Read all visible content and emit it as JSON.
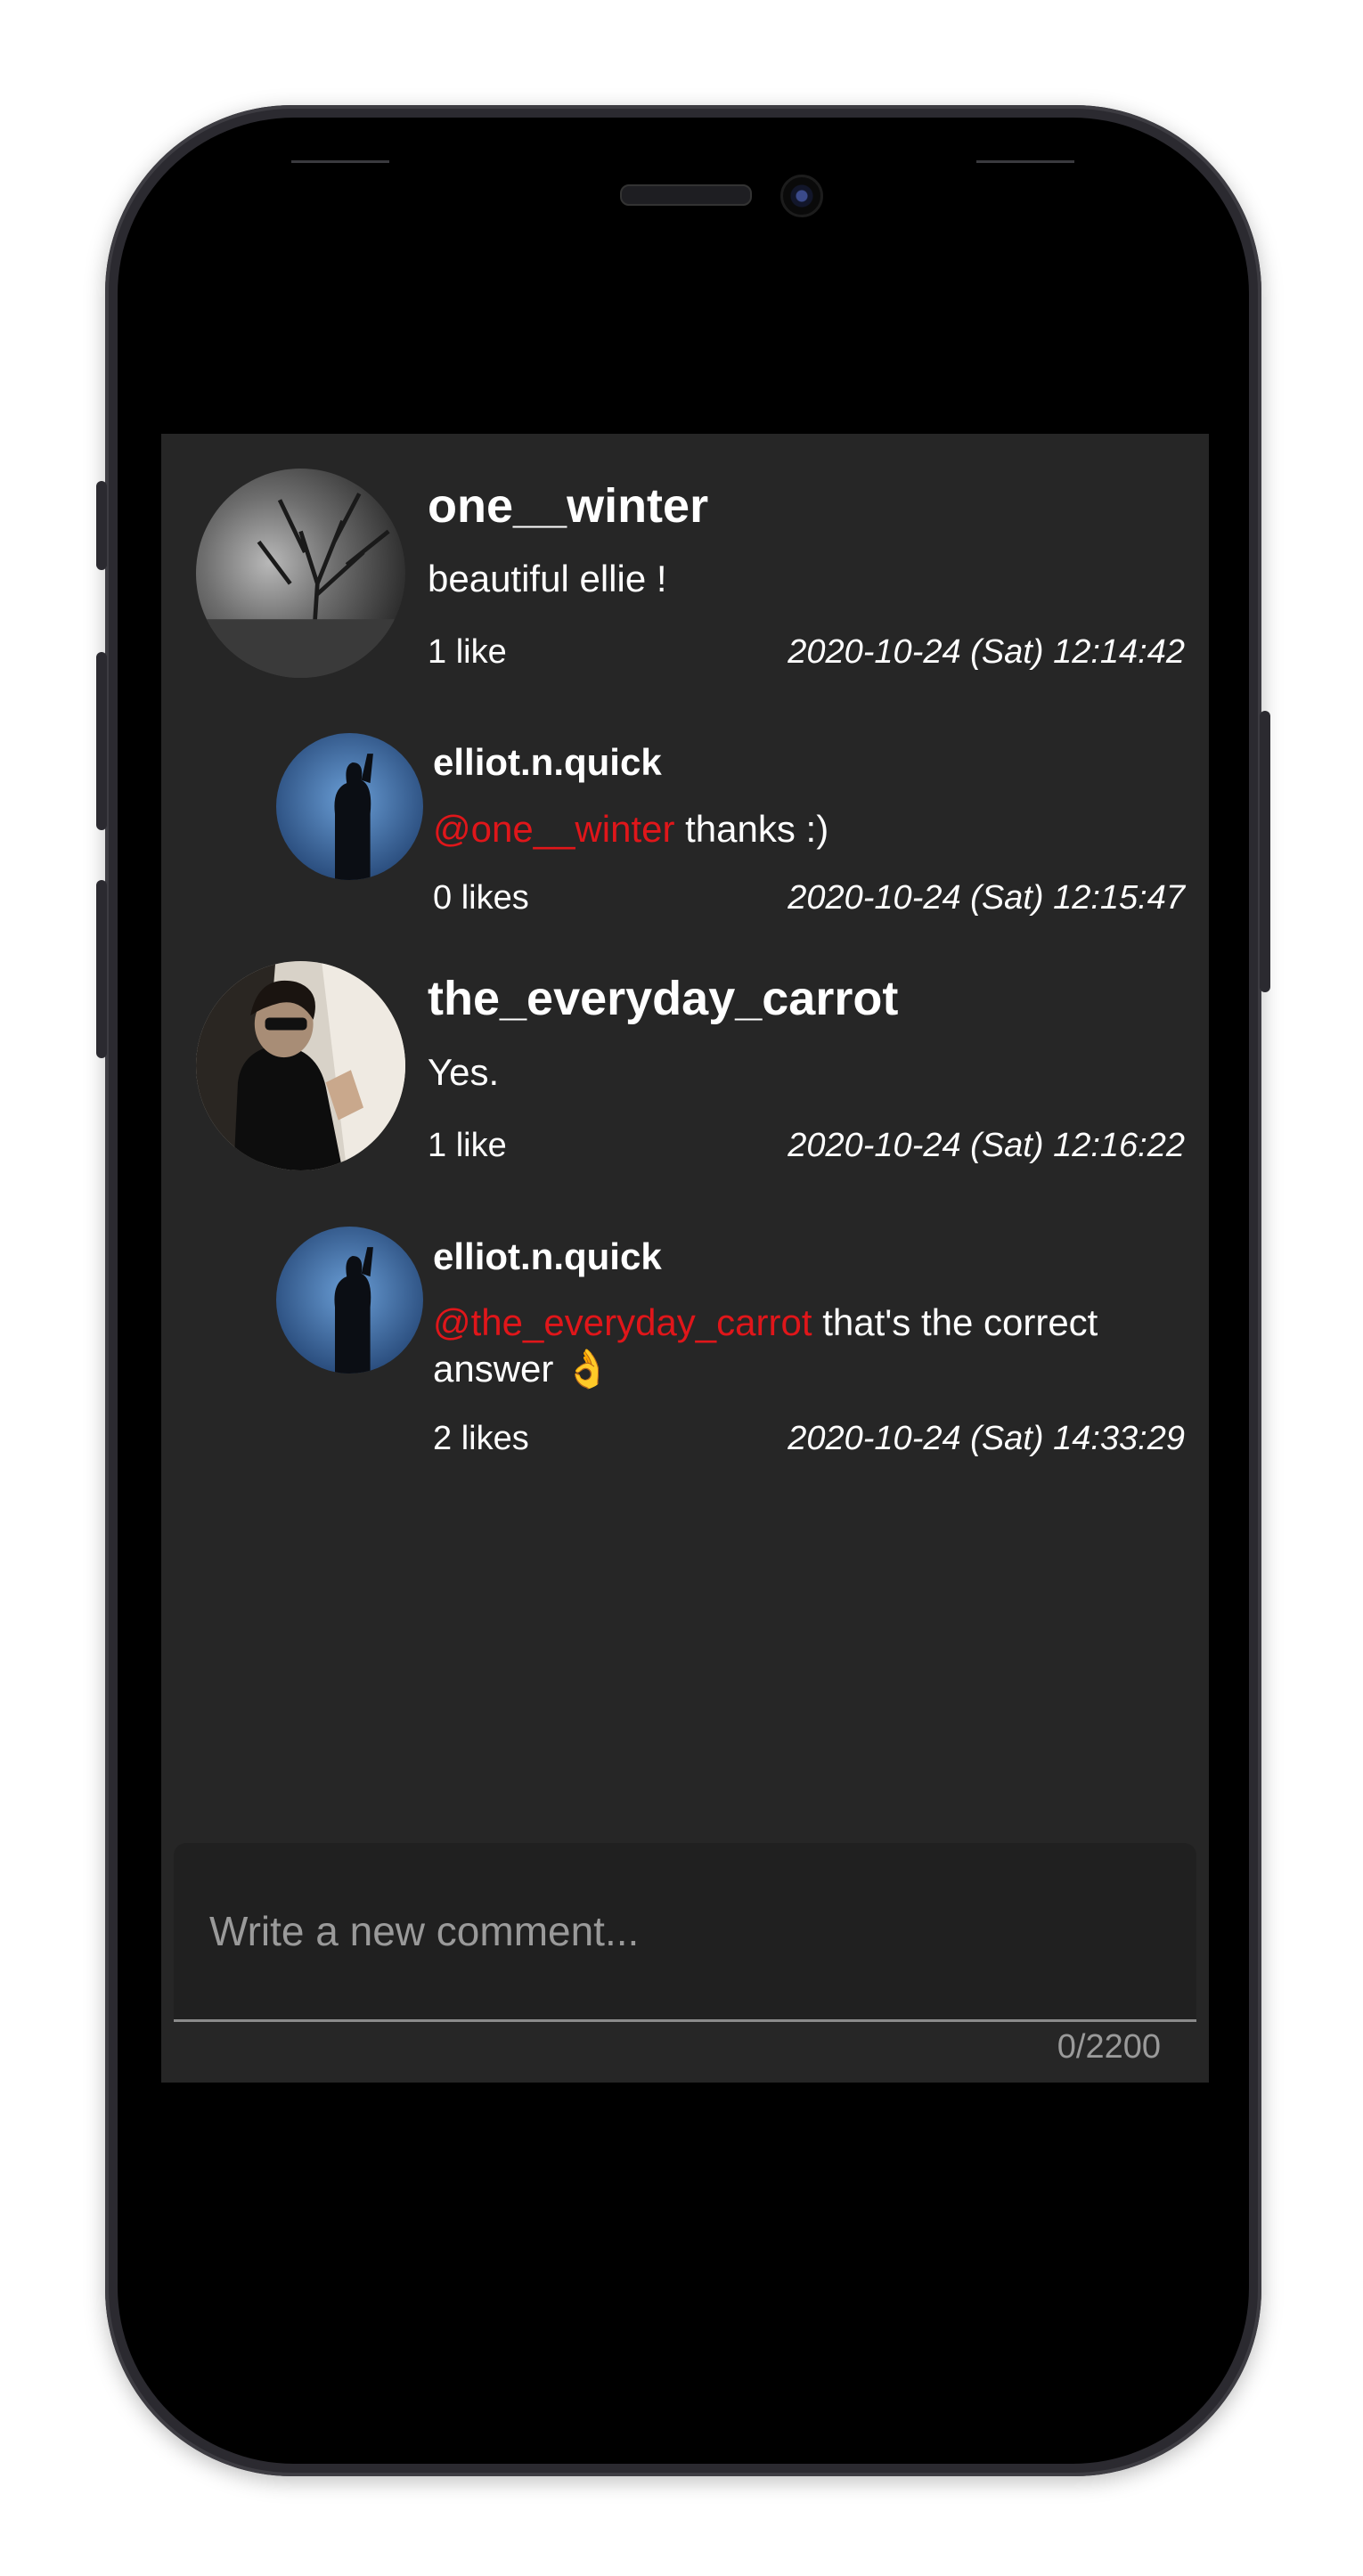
{
  "comments": [
    {
      "username": "one__winter",
      "mention": "",
      "text": "beautiful ellie !",
      "likes": "1 like",
      "timestamp": "2020-10-24 (Sat) 12:14:42"
    },
    {
      "username": "elliot.n.quick",
      "mention": "@one__winter",
      "text": " thanks :)",
      "likes": "0 likes",
      "timestamp": "2020-10-24 (Sat) 12:15:47"
    },
    {
      "username": "the_everyday_carrot",
      "mention": "",
      "text": "Yes.",
      "likes": "1 like",
      "timestamp": "2020-10-24 (Sat) 12:16:22"
    },
    {
      "username": "elliot.n.quick",
      "mention": "@the_everyday_carrot",
      "text": " that's the correct answer 👌",
      "likes": "2 likes",
      "timestamp": "2020-10-24 (Sat) 14:33:29"
    }
  ],
  "composer": {
    "placeholder": "Write a new comment...",
    "counter": "0/2200"
  },
  "colors": {
    "mention": "#e0161a",
    "screen_bg": "#262626"
  }
}
